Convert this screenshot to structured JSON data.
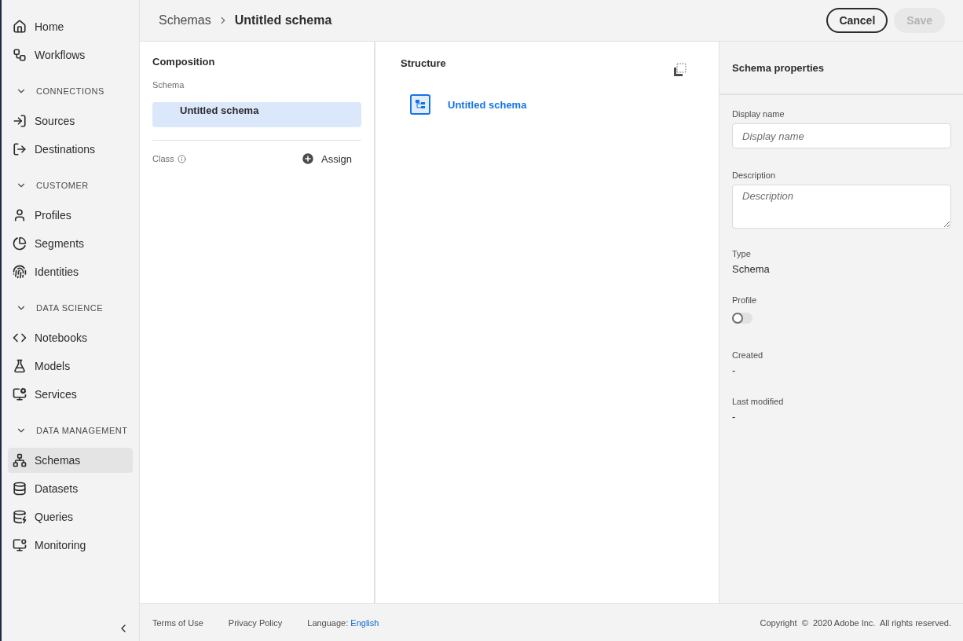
{
  "sidebar": {
    "items": [
      {
        "kind": "link",
        "label": "Home",
        "selected": false
      },
      {
        "kind": "link",
        "label": "Workflows",
        "selected": false
      },
      {
        "kind": "heading",
        "label": "CONNECTIONS",
        "expanded": true
      },
      {
        "kind": "link",
        "label": "Sources",
        "selected": false
      },
      {
        "kind": "link",
        "label": "Destinations",
        "selected": false
      },
      {
        "kind": "heading",
        "label": "CUSTOMER",
        "expanded": true
      },
      {
        "kind": "link",
        "label": "Profiles",
        "selected": false
      },
      {
        "kind": "link",
        "label": "Segments",
        "selected": false
      },
      {
        "kind": "link",
        "label": "Identities",
        "selected": false
      },
      {
        "kind": "heading",
        "label": "DATA SCIENCE",
        "expanded": true
      },
      {
        "kind": "link",
        "label": "Notebooks",
        "selected": false
      },
      {
        "kind": "link",
        "label": "Models",
        "selected": false
      },
      {
        "kind": "link",
        "label": "Services",
        "selected": false
      },
      {
        "kind": "heading",
        "label": "DATA MANAGEMENT",
        "expanded": true
      },
      {
        "kind": "link",
        "label": "Schemas",
        "selected": true
      },
      {
        "kind": "link",
        "label": "Datasets",
        "selected": false
      },
      {
        "kind": "link",
        "label": "Queries",
        "selected": false
      },
      {
        "kind": "link",
        "label": "Monitoring",
        "selected": false
      }
    ]
  },
  "breadcrumb": [
    "Schemas",
    "Untitled schema"
  ],
  "header_buttons": {
    "cancel": "Cancel",
    "save": "Save",
    "save_disabled": true
  },
  "composition": {
    "title": "Composition",
    "schema_label": "Schema",
    "schema_item": {
      "label": "Untitled schema",
      "selected": true
    },
    "class_label": "Class",
    "assign": "Assign"
  },
  "structure": {
    "title": "Structure",
    "root": "Untitled schema"
  },
  "properties": {
    "title": "Schema properties",
    "display_name": {
      "label": "Display name",
      "placeholder": "Display name"
    },
    "description": {
      "label": "Description",
      "placeholder": "Description"
    },
    "type": {
      "label": "Type",
      "value": "Schema"
    },
    "profile": {
      "label": "Profile",
      "on": false
    },
    "created": {
      "label": "Created",
      "value": "-"
    },
    "last_modified": {
      "label": "Last modified",
      "value": "-"
    }
  },
  "footer": {
    "links": [
      "Terms of Use",
      "Privacy Policy"
    ],
    "language_label": "Language:",
    "language": "English",
    "copyright": "Copyright  ©  2020 Adobe Inc.  All rights reserved."
  }
}
